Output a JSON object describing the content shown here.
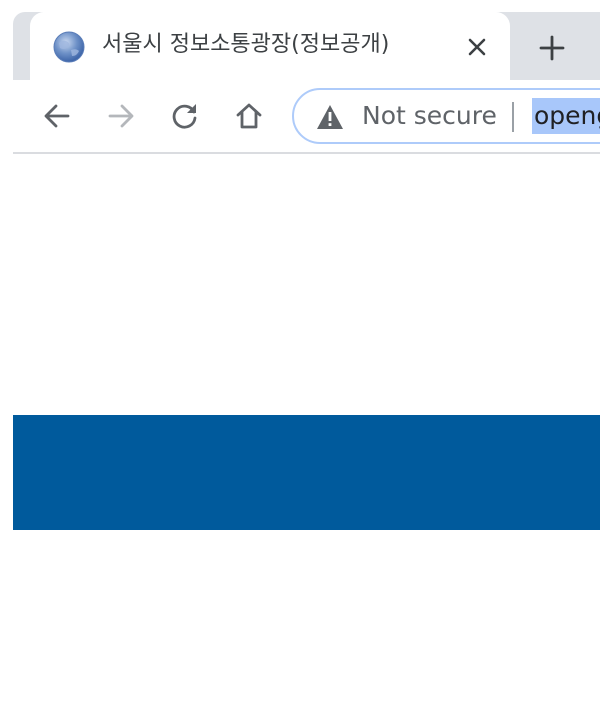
{
  "tab": {
    "title": "서울시 정보소통광장(정보공개)",
    "favicon": "globe-icon",
    "close_icon": "close-icon"
  },
  "newtab": {
    "icon": "plus-icon"
  },
  "toolbar": {
    "back_icon": "back-arrow-icon",
    "forward_icon": "forward-arrow-icon",
    "reload_icon": "reload-icon",
    "home_icon": "home-icon"
  },
  "omnibox": {
    "warning_icon": "warning-triangle-icon",
    "security_label": "Not secure",
    "url": "openg"
  },
  "colors": {
    "tabstrip_bg": "#dee1e6",
    "omnibox_border": "#aecbfa",
    "url_highlight": "#a8c7fa",
    "band_blue": "#005a9c"
  }
}
